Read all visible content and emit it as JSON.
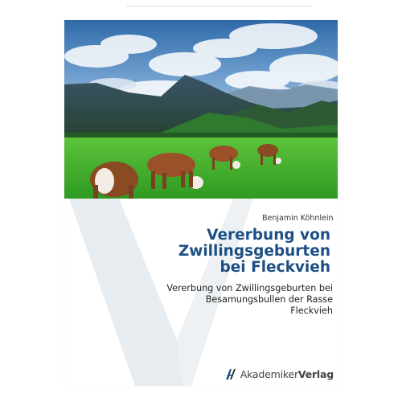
{
  "book": {
    "author": "Benjamin Köhnlein",
    "title": "Vererbung von Zwillingsgeburten bei Fleckvieh",
    "subtitle": "Vererbung von Zwillingsgeburten bei Besamungsbullen der Rasse Fleckvieh",
    "publisher_prefix": "Akademiker",
    "publisher_suffix": "Verlag"
  },
  "colors": {
    "title": "#1d4f84",
    "v_shape": "#e6ecef",
    "sky_top": "#2f6aa8",
    "grass": "#3fae2c"
  },
  "icons": {
    "publisher_logo": "akademiker-verlag-logo-icon"
  }
}
